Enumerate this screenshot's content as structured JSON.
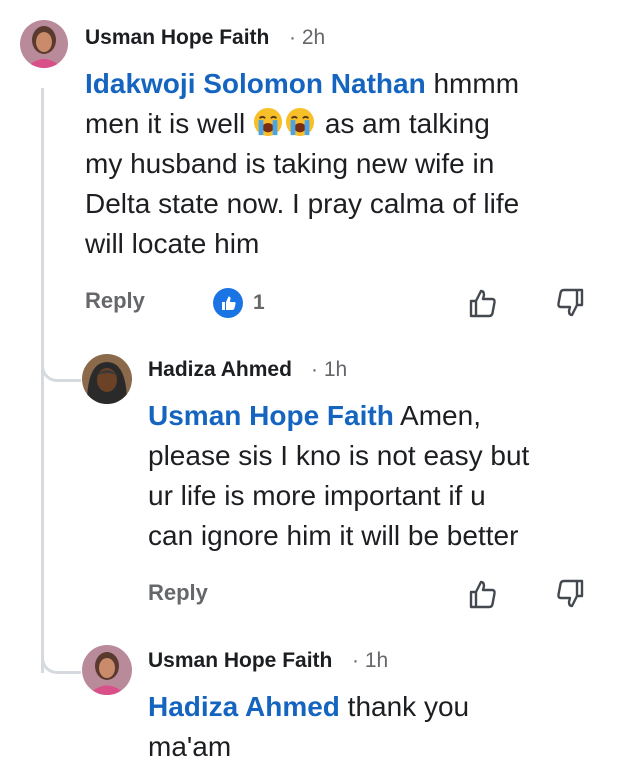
{
  "comments": [
    {
      "author": "Usman Hope Faith",
      "time": "· 2h",
      "mention": "Idakwoji Solomon Nathan",
      "text_line1": " hmmm",
      "text_line2_pre": "men it is well ",
      "text_line2_post": " as am talking",
      "text_line3": "my husband is taking new wife in",
      "text_line4": "Delta state now. I pray calma of life",
      "text_line5": "will locate him",
      "emojis": [
        "loudly-crying-face",
        "loudly-crying-face"
      ],
      "reply_label": "Reply",
      "like_count": "1"
    },
    {
      "author": "Hadiza Ahmed",
      "time": "· 1h",
      "mention": "Usman Hope Faith",
      "text_line1": " Amen,",
      "text_line2": "please sis I kno is not easy but",
      "text_line3": "ur life is more important if u",
      "text_line4": "can ignore him it will be better",
      "reply_label": "Reply"
    },
    {
      "author": "Usman Hope Faith",
      "time": "· 1h",
      "mention": "Hadiza Ahmed",
      "text_line1": " thank you",
      "text_line2": "ma'am"
    }
  ],
  "colors": {
    "mention": "#1565c0",
    "like_badge": "#1b74e4",
    "thread_line": "#d6d9de",
    "secondary_text": "#65676b"
  },
  "icons": [
    "thumbs-up-icon",
    "thumbs-down-icon",
    "like-reaction-icon"
  ]
}
